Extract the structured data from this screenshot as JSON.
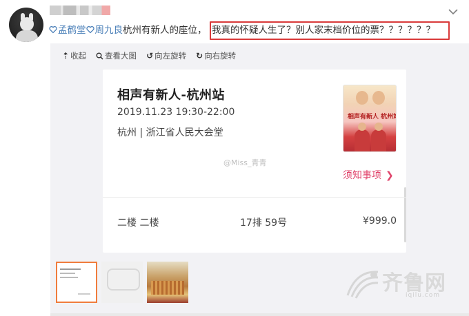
{
  "post": {
    "mention1": "孟鹤堂",
    "mention2": "周九良",
    "text": "杭州有新人的座位，",
    "highlighted_text": "我真的怀疑人生了？别人家末档价位的票？？？？？？"
  },
  "toolbar": {
    "collapse_label": "收起",
    "view_large_label": "查看大图",
    "rotate_left_label": "向左旋转",
    "rotate_right_label": "向右旋转"
  },
  "ticket": {
    "title": "相声有新人-杭州站",
    "datetime": "2019.11.23 19:30-22:00",
    "venue": "杭州 | 浙江省人民大会堂",
    "notice_label": "须知事项",
    "floor": "二楼 二楼",
    "seat": "17排 59号",
    "price": "¥999.0",
    "poster_title": "相声有新人 杭州站"
  },
  "watermark": {
    "weibo": "@Miss_青青"
  },
  "logo": {
    "name": "齐鲁网",
    "url": "iqilu.com"
  },
  "colors": {
    "highlight_border": "#d93a3a",
    "mention": "#eb7350",
    "notice": "#e0446b",
    "thumb_active_border": "#f07c3c",
    "panel_background": "#f2f2f5"
  },
  "icons": {
    "collapse": "arrow-up-icon",
    "view_large": "search-icon",
    "rotate_left": "rotate-left-icon",
    "rotate_right": "rotate-right-icon",
    "dropdown": "chevron-down-icon",
    "mention": "weibo-heart-icon"
  }
}
